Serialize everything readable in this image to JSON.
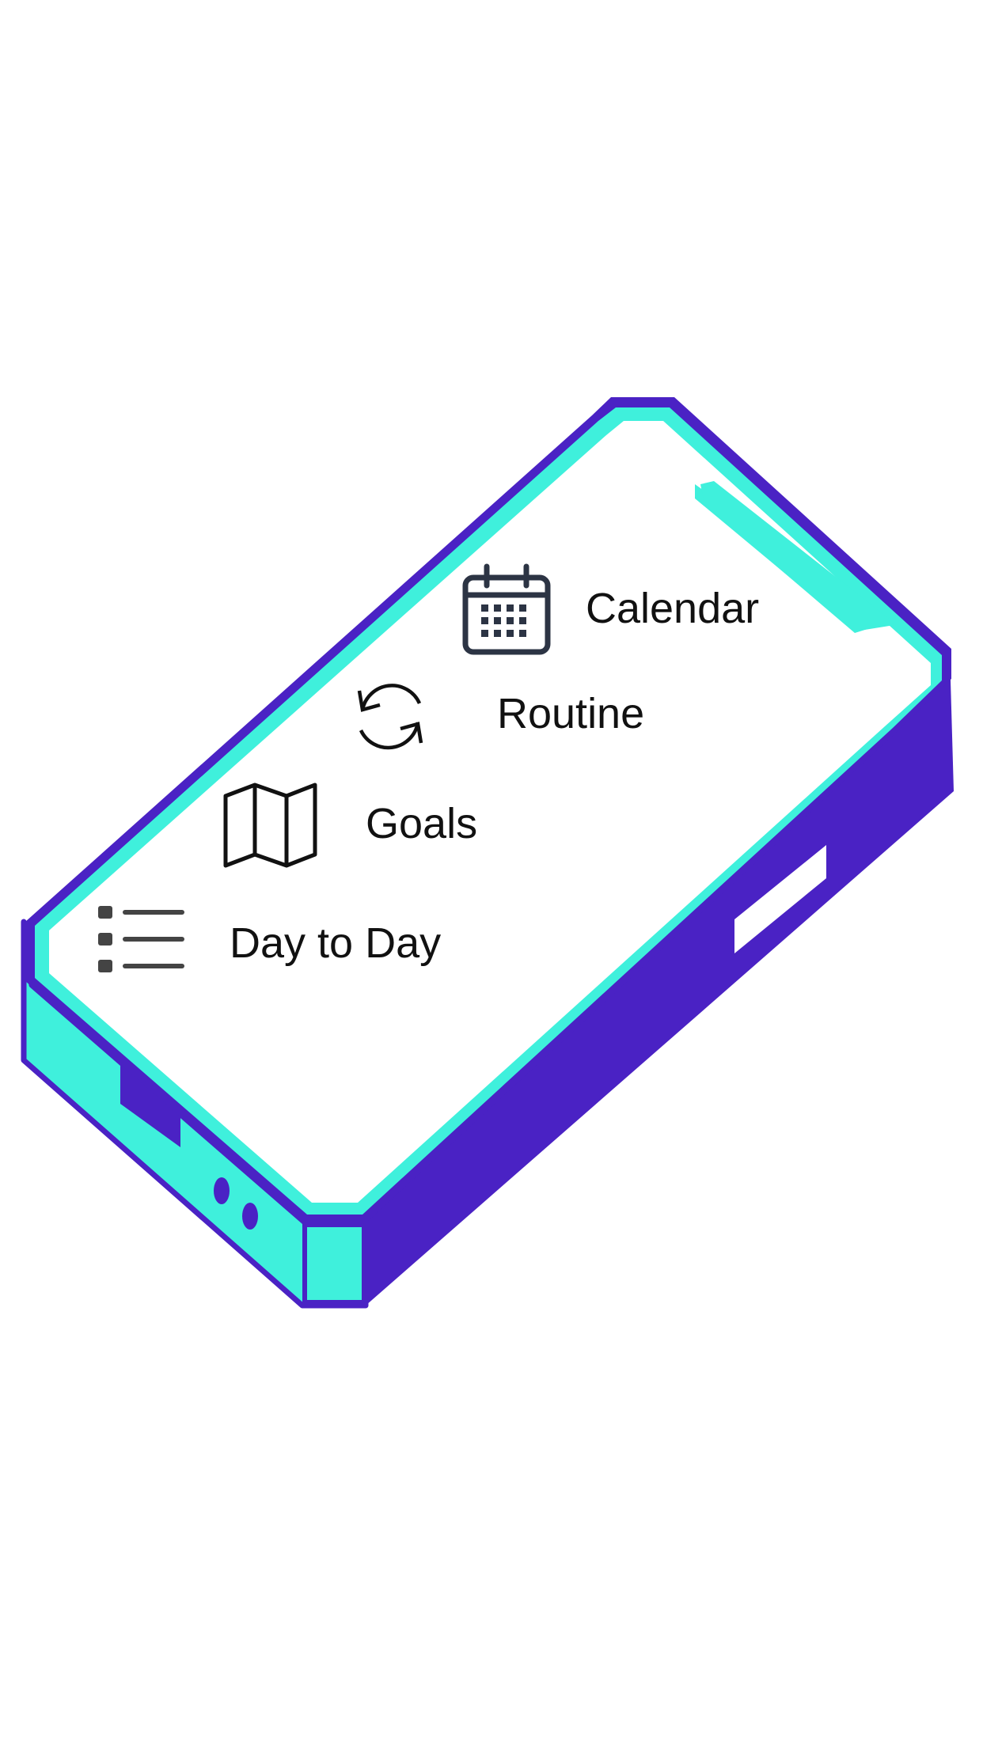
{
  "colors": {
    "phone_body": "#4a22c4",
    "phone_edge": "#3ff0dc",
    "screen": "#ffffff",
    "icon_stroke": "#2c3444",
    "label_text": "#111111"
  },
  "menu": {
    "items": [
      {
        "label": "Calendar",
        "icon": "calendar-icon"
      },
      {
        "label": "Routine",
        "icon": "refresh-icon"
      },
      {
        "label": "Goals",
        "icon": "map-icon"
      },
      {
        "label": "Day to Day",
        "icon": "list-icon"
      }
    ]
  }
}
